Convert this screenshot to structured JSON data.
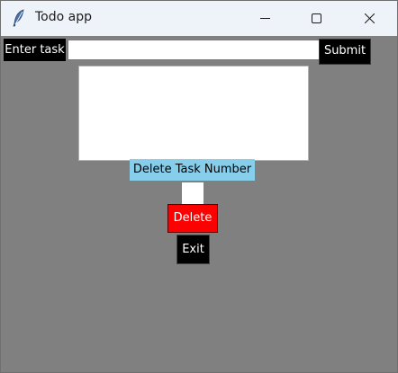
{
  "window": {
    "title": "Todo app",
    "icon": "feather-icon",
    "controls": {
      "minimize_icon": "minimize-icon",
      "maximize_icon": "maximize-icon",
      "close_icon": "close-icon"
    }
  },
  "form": {
    "task_label": "Enter task",
    "task_input_value": "",
    "submit_label": "Submit"
  },
  "task_list": {
    "items": []
  },
  "delete_section": {
    "label": "Delete Task Number",
    "number_input_value": "",
    "delete_label": "Delete",
    "exit_label": "Exit"
  },
  "colors": {
    "background": "#808080",
    "label_bg": "#000000",
    "delete_label_bg": "#87ceeb",
    "delete_button_bg": "#ff0000",
    "text_light": "#ffffff"
  }
}
